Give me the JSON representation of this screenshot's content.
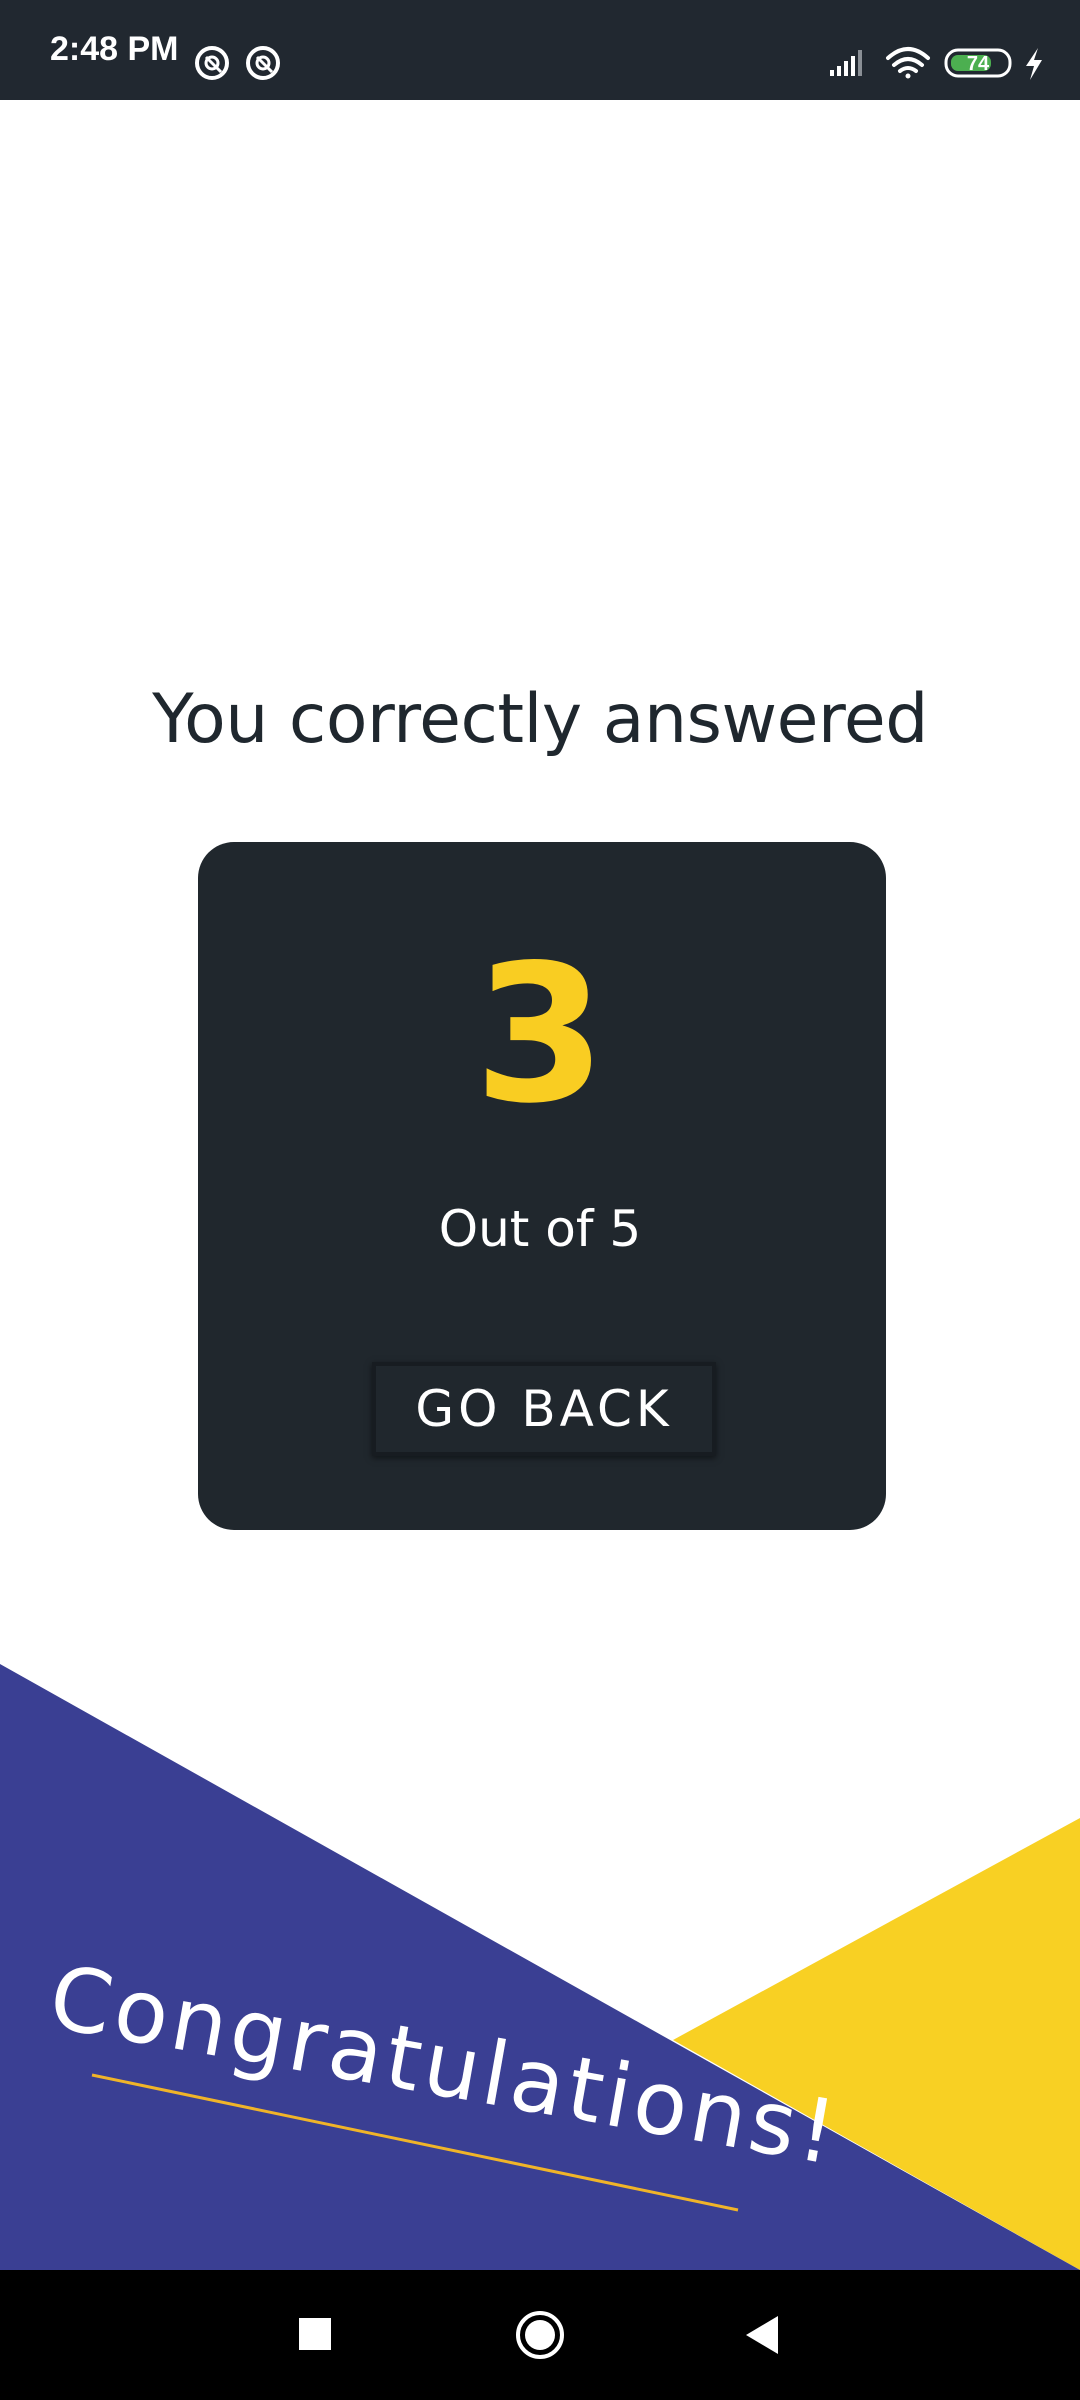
{
  "status_bar": {
    "time": "2:48 PM",
    "battery_level": "74",
    "icons": [
      "at-sign-icon",
      "at-sign-icon",
      "signal-icon",
      "wifi-icon",
      "battery-icon",
      "charging-icon"
    ]
  },
  "result": {
    "heading": "You correctly answered",
    "score": "3",
    "total_text": "Out of 5",
    "go_back_label": "GO BACK"
  },
  "banner": {
    "text": "Congratulations!"
  },
  "nav_bar": {
    "icons": [
      "recents-square-icon",
      "home-circle-icon",
      "back-triangle-icon"
    ]
  },
  "colors": {
    "status_bar": "#212830",
    "card": "#20272d",
    "score": "#f9cd22",
    "indigo": "#3a3f93",
    "yellow": "#f8d023",
    "heading_text": "#1f272e"
  }
}
